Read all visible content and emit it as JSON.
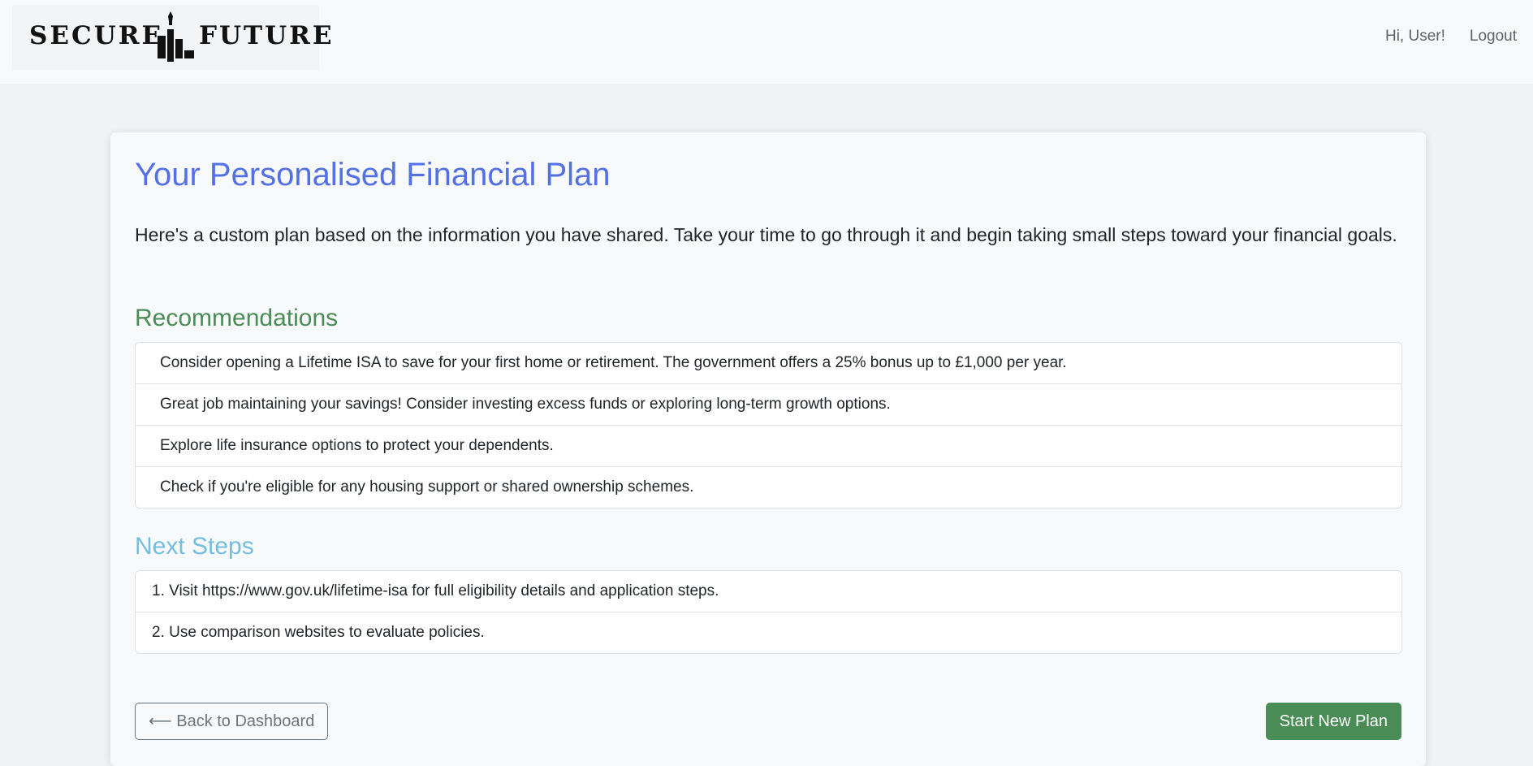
{
  "brand": {
    "left_word": "SECURE",
    "right_word": "FUTURE",
    "mark_icon": "bar-chart-rocket-icon"
  },
  "nav": {
    "greeting": "Hi, User!",
    "logout": "Logout"
  },
  "plan": {
    "title": "Your Personalised Financial Plan",
    "intro": "Here's a custom plan based on the information you have shared. Take your time to go through it and begin taking small steps toward your financial goals.",
    "recommendations_title": "Recommendations",
    "recommendations": [
      "Consider opening a Lifetime ISA to save for your first home or retirement. The government offers a 25% bonus up to £1,000 per year.",
      "Great job maintaining your savings! Consider investing excess funds or exploring long-term growth options.",
      "Explore life insurance options to protect your dependents.",
      "Check if you're eligible for any housing support or shared ownership schemes."
    ],
    "next_steps_title": "Next Steps",
    "next_steps": [
      "1. Visit https://www.gov.uk/lifetime-isa for full eligibility details and application steps.",
      "2. Use comparison websites to evaluate policies."
    ]
  },
  "actions": {
    "back": "⟵ Back to Dashboard",
    "start_new": "Start New Plan"
  },
  "colors": {
    "title": "#5470e6",
    "recommendations": "#4a8c55",
    "next_steps": "#72bfdf",
    "primary_button": "#4a8c55"
  }
}
